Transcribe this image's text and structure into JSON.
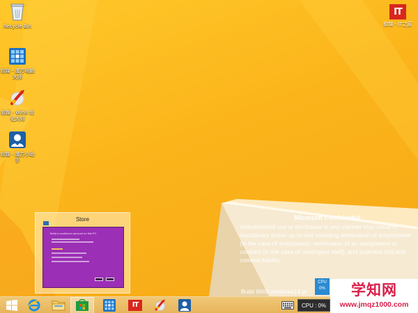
{
  "desktop": {
    "icons": [
      {
        "id": "recycle-bin",
        "label": "Recycle Bin",
        "icon": "recycle-bin-icon"
      },
      {
        "id": "magic-cube-optimizer",
        "label": "软媒 - 魔方电脑大师",
        "icon": "magic-cube-icon"
      },
      {
        "id": "win8-optimizer",
        "label": "软媒 - Win8 优化大师",
        "icon": "win8-optimizer-icon"
      },
      {
        "id": "magic-cube-helper",
        "label": "软媒 - 魔方小助手",
        "icon": "user-helper-icon"
      }
    ],
    "brand_logo": {
      "mark": "IT",
      "label": "软媒 - IT之家"
    }
  },
  "watermark": {
    "title": "Microsoft Confidential",
    "body": "Unauthorized use or disclosure in any manner may result in disciplinary action up to and including termination of employment (in the case of employees), termination of an assignment or contract (in the case of contingent staff), and potential civil and criminal liability.",
    "build": "Build 9600.winblues14.pr"
  },
  "thumbnail_preview": {
    "title": "Store",
    "window_heading": "Build a continuum account on this PC"
  },
  "cpu_gadget": {
    "label": "CPU",
    "value": "0%"
  },
  "taskbar": {
    "buttons": [
      {
        "id": "start",
        "icon": "windows-start-icon",
        "active": false
      },
      {
        "id": "ie",
        "icon": "internet-explorer-icon",
        "active": false
      },
      {
        "id": "explorer",
        "icon": "file-explorer-icon",
        "active": false
      },
      {
        "id": "store",
        "icon": "store-icon",
        "active": true
      },
      {
        "id": "magic-cube",
        "icon": "magic-cube-icon",
        "active": false
      },
      {
        "id": "ithome",
        "icon": "ithome-icon",
        "active": false
      },
      {
        "id": "win8-optimizer",
        "icon": "win8-optimizer-icon",
        "active": false
      },
      {
        "id": "helper",
        "icon": "user-helper-icon",
        "active": false
      }
    ],
    "tray": {
      "keyboard_icon": "keyboard-icon",
      "cpu_text": "CPU : 0%"
    }
  },
  "site_mark": {
    "title": "学知网",
    "url": "www.jmqz1000.com"
  },
  "colors": {
    "wallpaper": "#f7b21a",
    "taskbar": "#e9b85f",
    "store_purple": "#9b2fb5",
    "accent_blue": "#2b8ad1",
    "site_red": "#d91e4a",
    "logo_red": "#d9261c"
  }
}
